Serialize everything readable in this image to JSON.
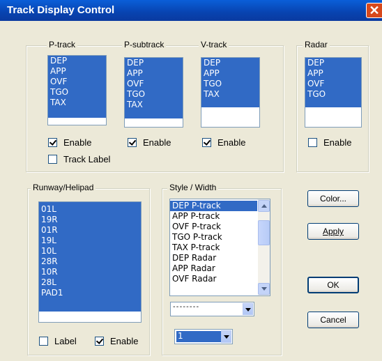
{
  "window": {
    "title": "Track Display Control",
    "close_glyph": "✕"
  },
  "ptrack": {
    "legend": "P-track",
    "items": [
      "DEP",
      "APP",
      "OVF",
      "TGO",
      "TAX"
    ],
    "enable_label": "Enable",
    "enabled": true,
    "track_label_label": "Track Label",
    "track_label_checked": false
  },
  "psubtrack": {
    "legend": "P-subtrack",
    "items": [
      "DEP",
      "APP",
      "OVF",
      "TGO",
      "TAX"
    ],
    "enable_label": "Enable",
    "enabled": true
  },
  "vtrack": {
    "legend": "V-track",
    "items": [
      "DEP",
      "APP",
      "TGO",
      "TAX"
    ],
    "enable_label": "Enable",
    "enabled": true
  },
  "radar": {
    "legend": "Radar",
    "items": [
      "DEP",
      "APP",
      "OVF",
      "TGO"
    ],
    "enable_label": "Enable",
    "enabled": false
  },
  "runway": {
    "legend": "Runway/Helipad",
    "items": [
      "01L",
      "19R",
      "01R",
      "19L",
      "10L",
      "28R",
      "10R",
      "28L",
      "PAD1"
    ],
    "label_label": "Label",
    "label_checked": false,
    "enable_label": "Enable",
    "enabled": true
  },
  "style": {
    "legend": "Style / Width",
    "items": [
      "DEP P-track",
      "APP P-track",
      "OVF P-track",
      "TGO P-track",
      "TAX P-track",
      "DEP Radar",
      "APP Radar",
      "OVF Radar"
    ],
    "selected": "DEP P-track",
    "line_style": "- - - - - - - -",
    "width": "1"
  },
  "buttons": {
    "color": "Color...",
    "apply": "Apply",
    "ok": "OK",
    "cancel": "Cancel"
  },
  "colors": {
    "selection": "#316ac5",
    "dialog_bg": "#ece9d8",
    "titlebar": "#0a5fd8"
  }
}
